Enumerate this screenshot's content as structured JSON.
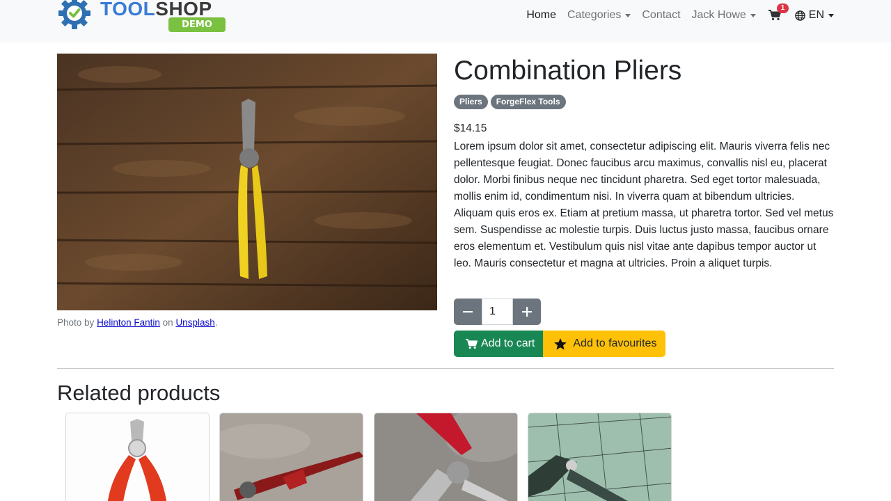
{
  "header": {
    "logo": {
      "tool": "TOOL",
      "shop": "SHOP",
      "badge": "DEMO"
    },
    "nav": {
      "home": "Home",
      "categories": "Categories",
      "contact": "Contact",
      "user": "Jack Howe",
      "cart_count": "1",
      "language": "EN"
    }
  },
  "product": {
    "title": "Combination Pliers",
    "tags": [
      "Pliers",
      "ForgeFlex Tools"
    ],
    "price": "$14.15",
    "description": "Lorem ipsum dolor sit amet, consectetur adipiscing elit. Mauris viverra felis nec pellentesque feugiat. Donec faucibus arcu maximus, convallis nisl eu, placerat dolor. Morbi finibus neque nec tincidunt pharetra. Sed eget tortor malesuada, mollis enim id, condimentum nisi. In viverra quam at bibendum ultricies. Aliquam quis eros ex. Etiam at pretium massa, ut pharetra tortor. Sed vel metus sem. Suspendisse ac molestie turpis. Duis luctus justo massa, faucibus ornare eros elementum et. Vestibulum quis nisl vitae ante dapibus tempor auctor ut leo. Mauris consectetur et magna at ultricies. Proin a aliquet turpis.",
    "quantity": "1",
    "add_to_cart": "Add to cart",
    "add_to_favourites": "Add to favourites",
    "credit": {
      "prefix": "Photo by",
      "author": "Helinton Fantin",
      "middle": "on",
      "site": "Unsplash",
      "suffix": "."
    }
  },
  "related": {
    "title": "Related products"
  },
  "colors": {
    "success": "#198754",
    "warning": "#ffc107",
    "secondary": "#6c757d",
    "danger": "#dc3545"
  }
}
